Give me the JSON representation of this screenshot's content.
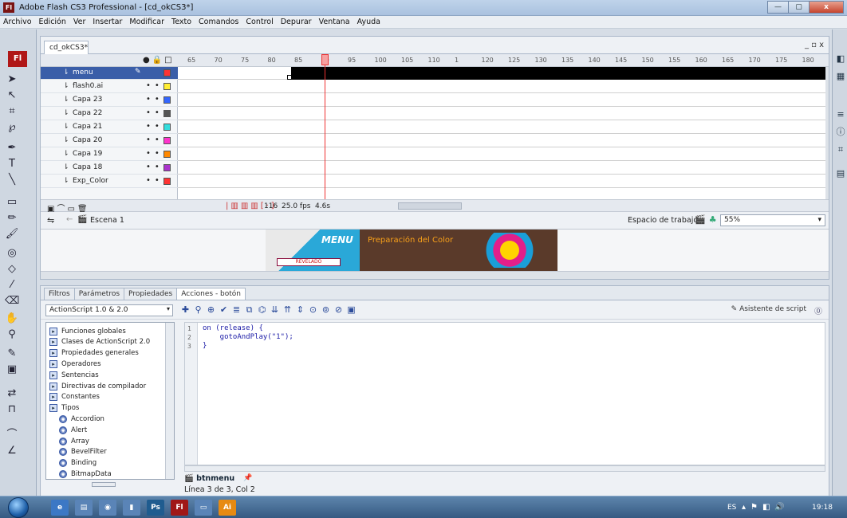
{
  "window": {
    "title": "Adobe Flash CS3 Professional - [cd_okCS3*]",
    "app_icon": "Fl",
    "btn_min": "—",
    "btn_max": "▢",
    "btn_close": "x"
  },
  "menu": [
    "Archivo",
    "Edición",
    "Ver",
    "Insertar",
    "Modificar",
    "Texto",
    "Comandos",
    "Control",
    "Depurar",
    "Ventana",
    "Ayuda"
  ],
  "toolbox": {
    "logo": "Fl"
  },
  "document": {
    "tab": "cd_okCS3*",
    "win_controls": "_ ▫ x",
    "frame_numbers": [
      "65",
      "70",
      "75",
      "80",
      "85",
      "90",
      "95",
      "100",
      "105",
      "110",
      "1",
      "120",
      "125",
      "130",
      "135",
      "140",
      "145",
      "150",
      "155",
      "160",
      "165",
      "170",
      "175",
      "180"
    ],
    "layers": [
      {
        "name": "menu",
        "selected": true,
        "color": "#ff3333"
      },
      {
        "name": "flash0.ai",
        "color": "#ffee33"
      },
      {
        "name": "Capa 23",
        "color": "#3366ff"
      },
      {
        "name": "Capa 22",
        "color": "#555555"
      },
      {
        "name": "Capa 21",
        "color": "#33dddd"
      },
      {
        "name": "Capa 20",
        "color": "#ff33cc"
      },
      {
        "name": "Capa 19",
        "color": "#ff8800"
      },
      {
        "name": "Capa 18",
        "color": "#aa33cc"
      },
      {
        "name": "Exp_Color",
        "color": "#ff3333"
      }
    ],
    "timeline_footer": {
      "frame": "116",
      "fps": "25.0 fps",
      "time": "4.6s"
    },
    "scene": "Escena 1",
    "workspace": "Espacio de trabajo ▾",
    "zoom": "55%",
    "banner": {
      "menu": "MENU",
      "title": "Preparación del Color",
      "button": "REVELADO"
    }
  },
  "actions_panel": {
    "tabs": [
      "Filtros",
      "Parámetros",
      "Propiedades",
      "Acciones - botón"
    ],
    "active_tab": 3,
    "as_version": "ActionScript 1.0 & 2.0",
    "script_assist": "Asistente de script",
    "tree": [
      "Funciones globales",
      "Clases de ActionScript 2.0",
      "Propiedades generales",
      "Operadores",
      "Sentencias",
      "Directivas de compilador",
      "Constantes",
      "Tipos",
      "Accordion",
      "Alert",
      "Array",
      "BevelFilter",
      "Binding",
      "BitmapData"
    ],
    "code": [
      {
        "n": "1",
        "text": "on (release) {"
      },
      {
        "n": "2",
        "text": "    gotoAndPlay(\"1\");"
      },
      {
        "n": "3",
        "text": "}"
      }
    ],
    "symbol_tab": "btnmenu",
    "status": "Línea 3 de 3, Col 2"
  },
  "taskbar": {
    "lang": "ES",
    "clock": "19:18",
    "apps": [
      "Ps",
      "Fl",
      "Ai"
    ]
  }
}
